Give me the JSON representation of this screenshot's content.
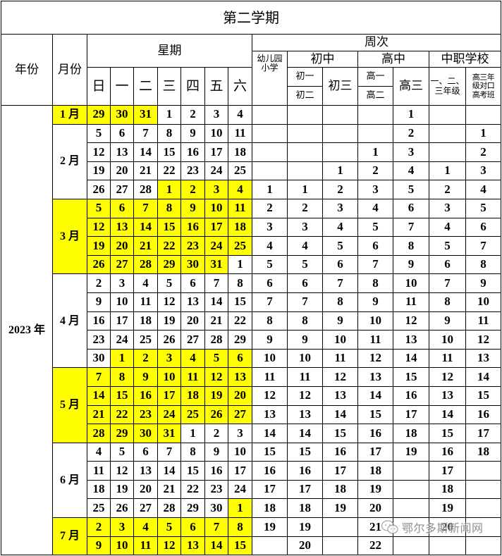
{
  "title": "第二学期",
  "header": {
    "year": "年份",
    "month": "月份",
    "weekday_group": "星期",
    "weekdays": [
      "日",
      "一",
      "二",
      "三",
      "四",
      "五",
      "六"
    ],
    "week_number_group": "周次",
    "kindergarten_primary": [
      "幼儿园",
      "小学"
    ],
    "junior_high": {
      "label": "初中",
      "grade12": [
        "初一",
        "初二"
      ],
      "grade3": "初三"
    },
    "senior_high": {
      "label": "高中",
      "grade12": [
        "高一",
        "高二"
      ],
      "grade3": "高三"
    },
    "vocational": {
      "label": "中职学校",
      "grade123": [
        "一、二、",
        "三年级"
      ],
      "grade3_exam": [
        "高三年",
        "级对口",
        "高考班"
      ]
    }
  },
  "year": "2023 年",
  "highlight_color": "#FFFF00",
  "week_columns": [
    "幼儿园小学",
    "初一初二",
    "初三",
    "高一高二",
    "高三",
    "中职一二三年级",
    "中职高三年级对口高考班"
  ],
  "months": [
    {
      "label": "1 月",
      "rows": 1,
      "highlight": true
    },
    {
      "label": "2 月",
      "rows": 4,
      "highlight": false
    },
    {
      "label": "3 月",
      "rows": 4,
      "highlight": true
    },
    {
      "label": "4 月",
      "rows": 5,
      "highlight": false
    },
    {
      "label": "5 月",
      "rows": 4,
      "highlight": true
    },
    {
      "label": "6 月",
      "rows": 4,
      "highlight": false
    },
    {
      "label": "7 月",
      "rows": 2,
      "highlight": true
    }
  ],
  "rows": [
    {
      "days": [
        29,
        30,
        31,
        1,
        2,
        3,
        4
      ],
      "highlight": [
        1,
        1,
        1,
        0,
        0,
        0,
        0
      ],
      "weeks": [
        "",
        "",
        "",
        "",
        "1",
        "",
        ""
      ]
    },
    {
      "days": [
        5,
        6,
        7,
        8,
        9,
        10,
        11
      ],
      "highlight": [
        0,
        0,
        0,
        0,
        0,
        0,
        0
      ],
      "weeks": [
        "",
        "",
        "",
        "",
        "2",
        "",
        "1"
      ]
    },
    {
      "days": [
        12,
        13,
        14,
        15,
        16,
        17,
        18
      ],
      "highlight": [
        0,
        0,
        0,
        0,
        0,
        0,
        0
      ],
      "weeks": [
        "",
        "",
        "",
        "1",
        "3",
        "",
        "2"
      ]
    },
    {
      "days": [
        19,
        20,
        21,
        22,
        23,
        24,
        25
      ],
      "highlight": [
        0,
        0,
        0,
        0,
        0,
        0,
        0
      ],
      "weeks": [
        "",
        "",
        "1",
        "2",
        "4",
        "1",
        "3"
      ]
    },
    {
      "days": [
        26,
        27,
        28,
        1,
        2,
        3,
        4
      ],
      "highlight": [
        0,
        0,
        0,
        1,
        1,
        1,
        1
      ],
      "weeks": [
        "1",
        "1",
        "2",
        "3",
        "5",
        "2",
        "4"
      ]
    },
    {
      "days": [
        5,
        6,
        7,
        8,
        9,
        10,
        11
      ],
      "highlight": [
        1,
        1,
        1,
        1,
        1,
        1,
        1
      ],
      "weeks": [
        "2",
        "2",
        "3",
        "4",
        "6",
        "3",
        "5"
      ]
    },
    {
      "days": [
        12,
        13,
        14,
        15,
        16,
        17,
        18
      ],
      "highlight": [
        1,
        1,
        1,
        1,
        1,
        1,
        1
      ],
      "weeks": [
        "3",
        "3",
        "4",
        "5",
        "7",
        "4",
        "6"
      ]
    },
    {
      "days": [
        19,
        20,
        21,
        22,
        23,
        24,
        25
      ],
      "highlight": [
        1,
        1,
        1,
        1,
        1,
        1,
        1
      ],
      "weeks": [
        "4",
        "4",
        "5",
        "6",
        "8",
        "5",
        "7"
      ]
    },
    {
      "days": [
        26,
        27,
        28,
        29,
        30,
        31,
        1
      ],
      "highlight": [
        1,
        1,
        1,
        1,
        1,
        1,
        0
      ],
      "weeks": [
        "5",
        "5",
        "6",
        "7",
        "9",
        "6",
        "8"
      ]
    },
    {
      "days": [
        2,
        3,
        4,
        5,
        6,
        7,
        8
      ],
      "highlight": [
        0,
        0,
        0,
        0,
        0,
        0,
        0
      ],
      "weeks": [
        "6",
        "6",
        "7",
        "8",
        "10",
        "7",
        "9"
      ]
    },
    {
      "days": [
        9,
        10,
        11,
        12,
        13,
        14,
        15
      ],
      "highlight": [
        0,
        0,
        0,
        0,
        0,
        0,
        0
      ],
      "weeks": [
        "7",
        "7",
        "8",
        "9",
        "11",
        "8",
        "10"
      ]
    },
    {
      "days": [
        16,
        17,
        18,
        19,
        20,
        21,
        22
      ],
      "highlight": [
        0,
        0,
        0,
        0,
        0,
        0,
        0
      ],
      "weeks": [
        "8",
        "8",
        "9",
        "10",
        "12",
        "9",
        "11"
      ]
    },
    {
      "days": [
        23,
        24,
        25,
        26,
        27,
        28,
        29
      ],
      "highlight": [
        0,
        0,
        0,
        0,
        0,
        0,
        0
      ],
      "weeks": [
        "9",
        "9",
        "10",
        "11",
        "13",
        "10",
        "12"
      ]
    },
    {
      "days": [
        30,
        1,
        2,
        3,
        4,
        5,
        6
      ],
      "highlight": [
        0,
        1,
        1,
        1,
        1,
        1,
        1
      ],
      "weeks": [
        "10",
        "10",
        "11",
        "12",
        "14",
        "11",
        "13"
      ]
    },
    {
      "days": [
        7,
        8,
        9,
        10,
        11,
        12,
        13
      ],
      "highlight": [
        1,
        1,
        1,
        1,
        1,
        1,
        1
      ],
      "weeks": [
        "11",
        "11",
        "12",
        "13",
        "15",
        "12",
        "14"
      ]
    },
    {
      "days": [
        14,
        15,
        16,
        17,
        18,
        19,
        20
      ],
      "highlight": [
        1,
        1,
        1,
        1,
        1,
        1,
        1
      ],
      "weeks": [
        "12",
        "12",
        "13",
        "14",
        "16",
        "13",
        "15"
      ]
    },
    {
      "days": [
        21,
        22,
        23,
        24,
        25,
        26,
        27
      ],
      "highlight": [
        1,
        1,
        1,
        1,
        1,
        1,
        1
      ],
      "weeks": [
        "13",
        "13",
        "14",
        "15",
        "17",
        "14",
        "16"
      ]
    },
    {
      "days": [
        28,
        29,
        30,
        31,
        1,
        2,
        3
      ],
      "highlight": [
        1,
        1,
        1,
        1,
        0,
        0,
        0
      ],
      "weeks": [
        "14",
        "14",
        "15",
        "16",
        "18",
        "15",
        "17"
      ]
    },
    {
      "days": [
        4,
        5,
        6,
        7,
        8,
        9,
        10
      ],
      "highlight": [
        0,
        0,
        0,
        0,
        0,
        0,
        0
      ],
      "weeks": [
        "15",
        "15",
        "16",
        "17",
        "19",
        "16",
        "18"
      ]
    },
    {
      "days": [
        11,
        12,
        13,
        14,
        15,
        16,
        17
      ],
      "highlight": [
        0,
        0,
        0,
        0,
        0,
        0,
        0
      ],
      "weeks": [
        "16",
        "16",
        "17",
        "18",
        "",
        "17",
        ""
      ]
    },
    {
      "days": [
        18,
        19,
        20,
        21,
        22,
        23,
        24
      ],
      "highlight": [
        0,
        0,
        0,
        0,
        0,
        0,
        0
      ],
      "weeks": [
        "17",
        "17",
        "18",
        "19",
        "",
        "18",
        ""
      ]
    },
    {
      "days": [
        25,
        26,
        27,
        28,
        29,
        30,
        1
      ],
      "highlight": [
        0,
        0,
        0,
        0,
        0,
        0,
        1
      ],
      "weeks": [
        "18",
        "18",
        "19",
        "20",
        "",
        "19",
        ""
      ]
    },
    {
      "days": [
        2,
        3,
        4,
        5,
        6,
        7,
        8
      ],
      "highlight": [
        1,
        1,
        1,
        1,
        1,
        1,
        1
      ],
      "weeks": [
        "19",
        "19",
        "",
        "21",
        "",
        "20",
        ""
      ]
    },
    {
      "days": [
        9,
        10,
        11,
        12,
        13,
        14,
        15
      ],
      "highlight": [
        1,
        1,
        1,
        1,
        1,
        1,
        1
      ],
      "weeks": [
        "",
        "20",
        "",
        "22",
        "",
        "",
        ""
      ]
    }
  ],
  "watermark": {
    "icon": "wechat-icon",
    "text": "鄂尔多斯新闻网"
  }
}
